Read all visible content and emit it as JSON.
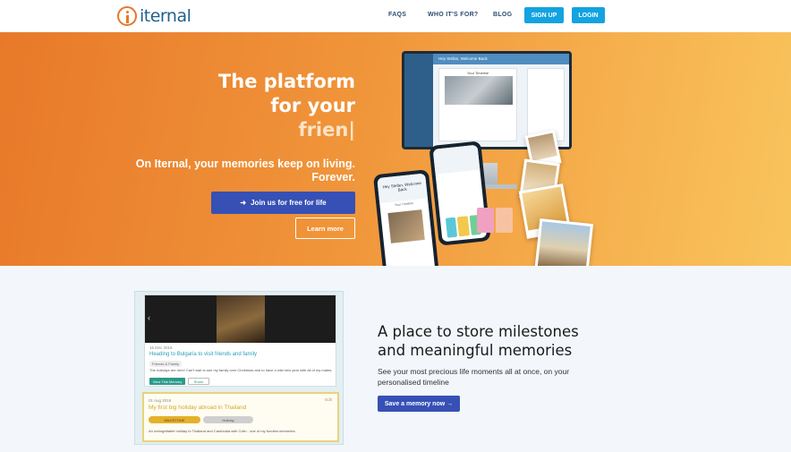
{
  "nav": {
    "logo_text": "iternal",
    "links": [
      "FAQS",
      "WHO IT'S FOR?",
      "BLOG"
    ],
    "signup_label": "SIGN UP",
    "login_label": "LOGIN"
  },
  "hero": {
    "title_line1": "The platform",
    "title_line2": "for your",
    "title_typed": "frien|",
    "subtitle_line1": "On Iternal, your memories keep on living.",
    "subtitle_line2": "Forever.",
    "join_label": "Join us for free for life",
    "learn_label": "Learn more",
    "monitor_header": "Hey Stefan, Welcome Back",
    "monitor_card_title": "Your Timeline",
    "phone_header": "Hey Stefan, Welcome Back",
    "phone_sub": "Your Timeline"
  },
  "section2": {
    "title_line1": "A place to store milestones",
    "title_line2": "and meaningful memories",
    "text": "See your most precious life moments all at once, on your personalised timeline",
    "save_label": "Save a memory now →"
  },
  "timeline": {
    "card1": {
      "date": "15 Dec 2016",
      "title": "Heading to Bulgaria to visit friends and family",
      "tag": "Friends & Family",
      "body": "The holidays are here! Can't wait to see my family over Christmas and to have a wild new year with all of my mates.",
      "view_label": "View This Memory",
      "share_label": "Share"
    },
    "card2": {
      "date": "01 Aug 2016",
      "edit": "Edit",
      "title": "My first big holiday abroad in Thailand",
      "badge": "MILESTONE",
      "badge2": "Holiday",
      "body": "An unforgettable holiday to Thailand and Cambodia with Colin - one of my fondest memories."
    }
  },
  "colors": {
    "accent_orange": "#e8792a",
    "primary_blue": "#3750b5",
    "nav_blue": "#13a3e0"
  }
}
